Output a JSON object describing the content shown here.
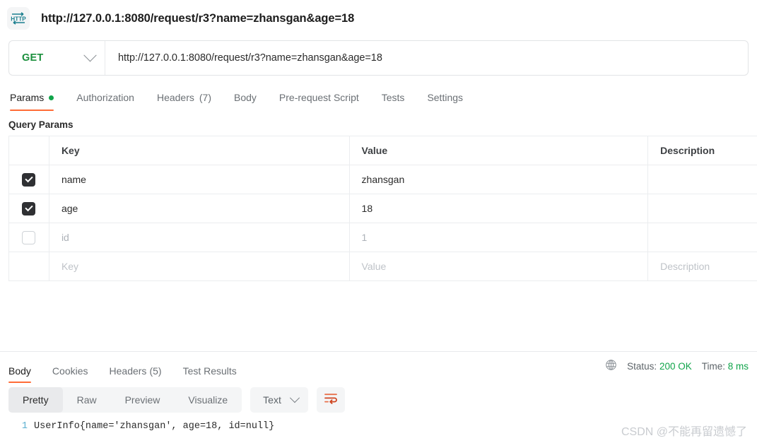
{
  "header": {
    "icon": "http-protocol-icon",
    "title": "http://127.0.0.1:8080/request/r3?name=zhansgan&age=18"
  },
  "request": {
    "method": "GET",
    "url": "http://127.0.0.1:8080/request/r3?name=zhansgan&age=18",
    "tabs": [
      {
        "label": "Params",
        "badge": "",
        "dot": true,
        "active": true
      },
      {
        "label": "Authorization",
        "badge": "",
        "dot": false,
        "active": false
      },
      {
        "label": "Headers",
        "badge": "(7)",
        "dot": false,
        "active": false
      },
      {
        "label": "Body",
        "badge": "",
        "dot": false,
        "active": false
      },
      {
        "label": "Pre-request Script",
        "badge": "",
        "dot": false,
        "active": false
      },
      {
        "label": "Tests",
        "badge": "",
        "dot": false,
        "active": false
      },
      {
        "label": "Settings",
        "badge": "",
        "dot": false,
        "active": false
      }
    ],
    "params_section_title": "Query Params",
    "columns": {
      "key": "Key",
      "value": "Value",
      "description": "Description"
    },
    "rows": [
      {
        "checked": true,
        "key": "name",
        "value": "zhansgan",
        "description": "",
        "disabled": false
      },
      {
        "checked": true,
        "key": "age",
        "value": "18",
        "description": "",
        "disabled": false
      },
      {
        "checked": false,
        "key": "id",
        "value": "1",
        "description": "",
        "disabled": true
      }
    ],
    "new_row": {
      "key_placeholder": "Key",
      "value_placeholder": "Value",
      "description_placeholder": "Description"
    }
  },
  "response": {
    "tabs": [
      {
        "label": "Body",
        "badge": "",
        "active": true
      },
      {
        "label": "Cookies",
        "badge": "",
        "active": false
      },
      {
        "label": "Headers",
        "badge": "(5)",
        "active": false
      },
      {
        "label": "Test Results",
        "badge": "",
        "active": false
      }
    ],
    "status_icon": "globe-icon",
    "status_label": "Status:",
    "status_value": "200 OK",
    "time_label": "Time:",
    "time_value": "8 ms",
    "format_tabs": [
      {
        "label": "Pretty",
        "active": true
      },
      {
        "label": "Raw",
        "active": false
      },
      {
        "label": "Preview",
        "active": false
      },
      {
        "label": "Visualize",
        "active": false
      }
    ],
    "content_type": "Text",
    "wrap_icon": "wrap-lines-icon",
    "body_lines": [
      {
        "number": "1",
        "text": "UserInfo{name='zhansgan', age=18, id=null}"
      }
    ]
  },
  "watermark": "CSDN @不能再留遗憾了",
  "colors": {
    "accent": "#ff6c37",
    "success": "#10a44a",
    "method": "#1a8f3c",
    "icon_teal": "#1b7f8f"
  }
}
